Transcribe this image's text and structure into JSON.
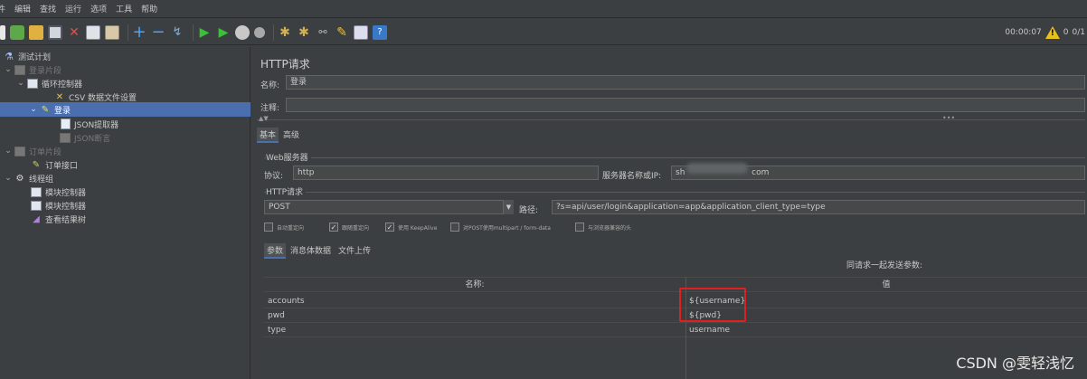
{
  "menubar": {
    "items": [
      "件",
      "编辑",
      "查找",
      "运行",
      "选项",
      "工具",
      "帮助"
    ]
  },
  "toolbar": {
    "icons": [
      "new-plan-icon",
      "templates-icon",
      "open-icon",
      "save-icon",
      "cut-icon",
      "copy-icon",
      "paste-icon",
      "expand-icon",
      "collapse-icon",
      "toggle-icon",
      "start-icon",
      "start-no-pause-icon",
      "stop-icon",
      "shutdown-icon",
      "clear-icon",
      "clear-all-icon",
      "search-icon",
      "reset-search-icon",
      "function-helper-icon",
      "help-icon"
    ],
    "elapsed_time": "00:00:07",
    "warning_count": "0",
    "thread_count": "0/1"
  },
  "tree": {
    "items": [
      {
        "label": "测试计划",
        "level": 0,
        "icon": "flask-icon"
      },
      {
        "label": "登录片段",
        "level": 0,
        "icon": "fragment-icon",
        "disabled": true,
        "expanded": true
      },
      {
        "label": "循环控制器",
        "level": 1,
        "icon": "loop-controller-icon",
        "expanded": true
      },
      {
        "label": "CSV 数据文件设置",
        "level": 2,
        "icon": "csv-config-icon"
      },
      {
        "label": "登录",
        "level": 2,
        "icon": "http-sampler-icon",
        "selected": true,
        "expanded": true
      },
      {
        "label": "JSON提取器",
        "level": 3,
        "icon": "json-extractor-icon"
      },
      {
        "label": "JSON断言",
        "level": 3,
        "icon": "json-assertion-icon",
        "disabled": true
      },
      {
        "label": "订单片段",
        "level": 0,
        "icon": "fragment-icon",
        "disabled": true,
        "expanded": true
      },
      {
        "label": "订单接口",
        "level": 1,
        "icon": "http-sampler-icon"
      },
      {
        "label": "线程组",
        "level": 0,
        "icon": "thread-group-icon",
        "expanded": true
      },
      {
        "label": "模块控制器",
        "level": 1,
        "icon": "module-controller-icon"
      },
      {
        "label": "模块控制器",
        "level": 1,
        "icon": "module-controller-icon"
      },
      {
        "label": "查看结果树",
        "level": 1,
        "icon": "results-tree-icon"
      }
    ]
  },
  "main": {
    "title": "HTTP请求",
    "name_label": "名称:",
    "name_value": "登录",
    "comment_label": "注释:",
    "comment_value": "",
    "tabs": [
      "基本",
      "高级"
    ],
    "web_server_legend": "Web服务器",
    "protocol_label": "协议:",
    "protocol_value": "http",
    "server_label": "服务器名称或IP:",
    "server_value_prefix": "sh",
    "server_value_suffix": "com",
    "http_request_legend": "HTTP请求",
    "method_value": "POST",
    "path_label": "路径:",
    "path_value": "?s=api/user/login&application=app&application_client_type=type",
    "checkboxes": [
      {
        "label": "自动重定向",
        "checked": false
      },
      {
        "label": "跟随重定向",
        "checked": true
      },
      {
        "label": "使用 KeepAlive",
        "checked": true
      },
      {
        "label": "对POST使用multipart / form-data",
        "checked": false
      },
      {
        "label": "与浏览器兼容的头",
        "checked": false
      }
    ],
    "sub_tabs": [
      "参数",
      "消息体数据",
      "文件上传"
    ],
    "table": {
      "caption": "同请求一起发送参数:",
      "col_name": "名称:",
      "col_value": "值",
      "rows": [
        {
          "name": "accounts",
          "value": "${username}"
        },
        {
          "name": "pwd",
          "value": "${pwd}"
        },
        {
          "name": "type",
          "value": "username"
        }
      ]
    }
  },
  "watermark": "CSDN @雯轻浅忆"
}
